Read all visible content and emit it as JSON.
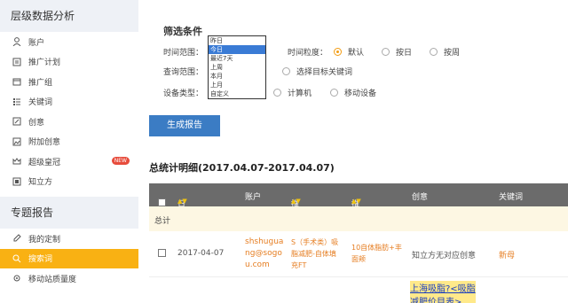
{
  "sidebar": {
    "section1_title": "层级数据分析",
    "items": [
      {
        "label": "账户"
      },
      {
        "label": "推广计划"
      },
      {
        "label": "推广组"
      },
      {
        "label": "关键词"
      },
      {
        "label": "创意"
      },
      {
        "label": "附加创意"
      },
      {
        "label": "超级皇冠",
        "badge": "NEW"
      },
      {
        "label": "知立方"
      }
    ],
    "section2_title": "专题报告",
    "items2": [
      {
        "label": "我的定制"
      },
      {
        "label": "搜索词"
      },
      {
        "label": "移动站质量度"
      }
    ]
  },
  "filters": {
    "title": "筛选条件",
    "time_range_label": "时间范围：",
    "query_range_label": "查询范围：",
    "device_type_label": "设备类型：",
    "granularity_label": "时间粒度：",
    "granularity_options": [
      "默认",
      "按日",
      "按周"
    ],
    "select_keywords": "选择目标关键词",
    "device_options": [
      "计算机",
      "移动设备"
    ],
    "dropdown_options": [
      "昨日",
      "今日",
      "最近7天",
      "上周",
      "本月",
      "上月",
      "自定义"
    ]
  },
  "generate_button": "生成报告",
  "summary_title": "总统计明细(2017.04.07-2017.04.07)",
  "table": {
    "headers": [
      "日期",
      "账户",
      "推广计划",
      "推广组",
      "创意",
      "关键词"
    ],
    "total_label": "总计",
    "row": {
      "date": "2017-04-07",
      "account_l1": "shshugua",
      "account_l2": "ng@sogo",
      "account_l3": "u.com",
      "plan_l1": "S（手术类）吸",
      "plan_l2": "脂减肥-自体填",
      "plan_l3": "充FT",
      "group_l1": "10自体脂肪+丰",
      "group_l2": "面颊",
      "creative": "知立方无对应创意",
      "keyword": "新母"
    },
    "extra_line1": "上海吸脂?<吸脂",
    "extra_line2": "减肥价目表>"
  }
}
